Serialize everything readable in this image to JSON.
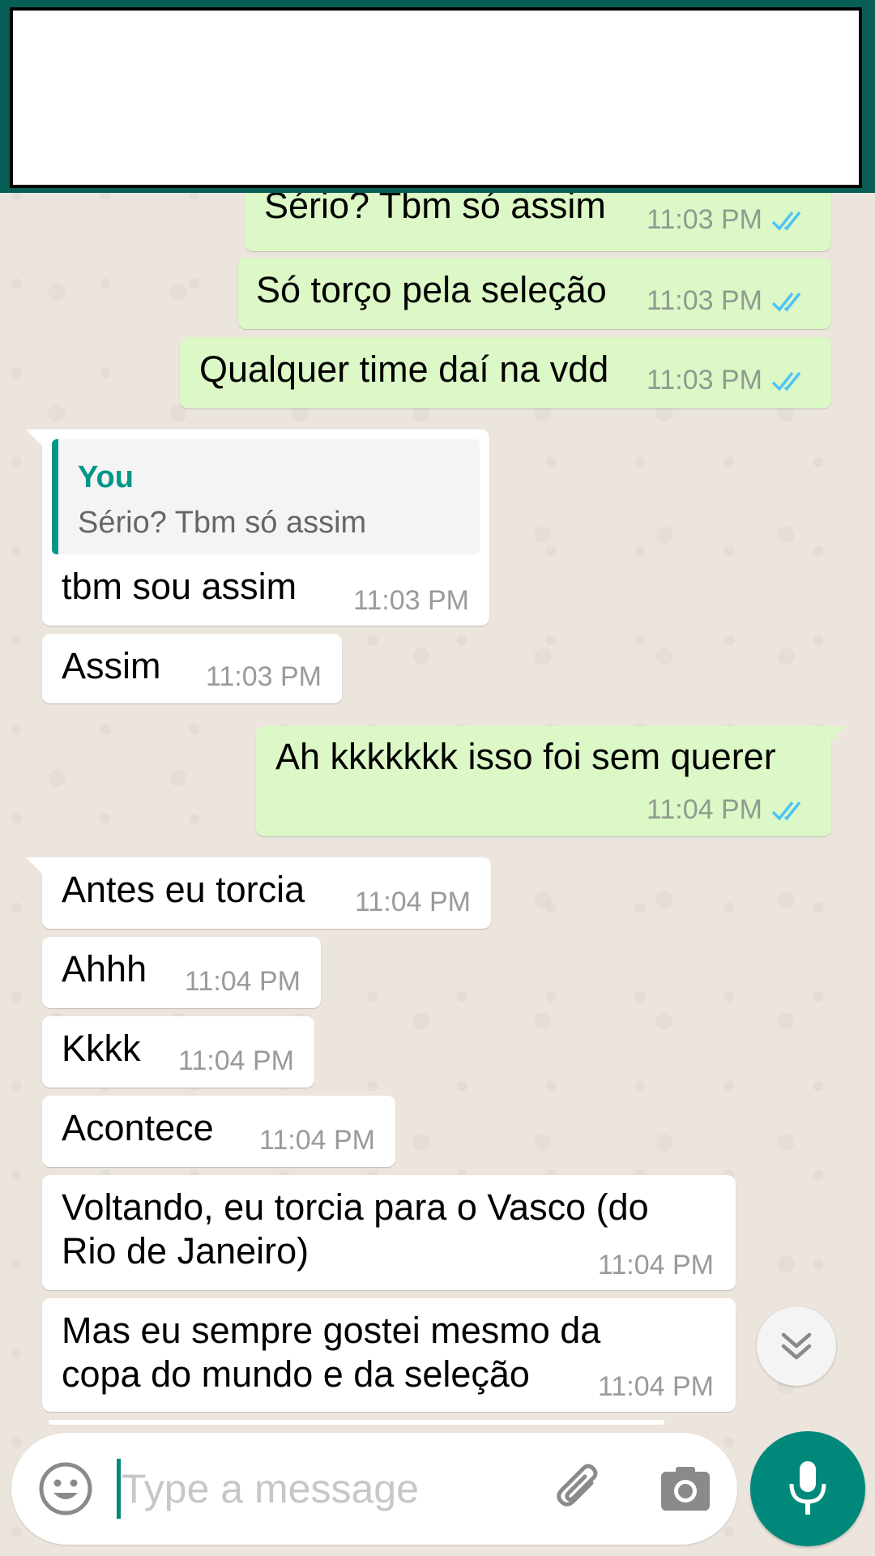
{
  "colors": {
    "header": "#075e54",
    "outgoing_bubble": "#dcf8c6",
    "incoming_bubble": "#ffffff",
    "accent": "#009688",
    "read_ticks": "#4fc3f7",
    "wallpaper": "#ece5dd"
  },
  "messages": [
    {
      "direction": "outgoing",
      "text": "Sério? Tbm só assim",
      "time": "11:03 PM",
      "status": "read"
    },
    {
      "direction": "outgoing",
      "text": "Só torço pela seleção",
      "time": "11:03 PM",
      "status": "read"
    },
    {
      "direction": "outgoing",
      "text": "Qualquer time daí na vdd",
      "time": "11:03 PM",
      "status": "read"
    },
    {
      "direction": "incoming",
      "quote_author": "You",
      "quote_text": "Sério? Tbm só assim",
      "text": "tbm sou assim",
      "time": "11:03 PM"
    },
    {
      "direction": "incoming",
      "text": "Assim",
      "time": "11:03 PM"
    },
    {
      "direction": "outgoing",
      "text": "Ah kkkkkkk isso foi sem querer",
      "time": "11:04 PM",
      "status": "read"
    },
    {
      "direction": "incoming",
      "text": "Antes eu torcia",
      "time": "11:04 PM"
    },
    {
      "direction": "incoming",
      "text": "Ahhh",
      "time": "11:04 PM"
    },
    {
      "direction": "incoming",
      "text": "Kkkk",
      "time": "11:04 PM"
    },
    {
      "direction": "incoming",
      "text": "Acontece",
      "time": "11:04 PM"
    },
    {
      "direction": "incoming",
      "text_line1": "Voltando, eu torcia para o Vasco (do",
      "text_line2": "Rio de Janeiro)",
      "time": "11:04 PM"
    },
    {
      "direction": "incoming",
      "text_line1": "Mas eu sempre gostei mesmo da",
      "text_line2": "copa do mundo e da seleção",
      "time": "11:04 PM"
    }
  ],
  "composer": {
    "placeholder": "Type a message",
    "emoji_icon": "emoji-icon",
    "attach_icon": "paperclip-icon",
    "camera_icon": "camera-icon",
    "mic_icon": "microphone-icon"
  },
  "scroll_down_icon": "double-chevron-down-icon"
}
